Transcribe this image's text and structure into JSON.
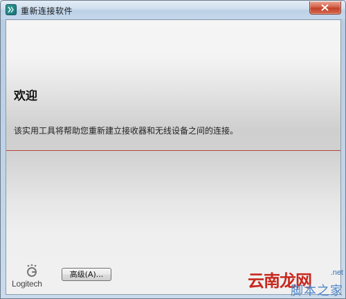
{
  "window": {
    "title": "重新连接软件",
    "icon": "logitech-app-icon",
    "close_icon": "close-icon"
  },
  "main": {
    "heading": "欢迎",
    "description": "该实用工具将帮助您重新建立接收器和无线设备之间的连接。"
  },
  "footer": {
    "logo_text": "Logitech",
    "advanced_button": "高级(A)..."
  },
  "watermark": {
    "main": "云南龙网",
    "dotnet": ".net",
    "sub": "脚本之家"
  },
  "colors": {
    "divider": "#b6453a",
    "close_button": "#c1432a",
    "watermark_red": "#c8281e",
    "watermark_blue": "#4c83c9"
  }
}
